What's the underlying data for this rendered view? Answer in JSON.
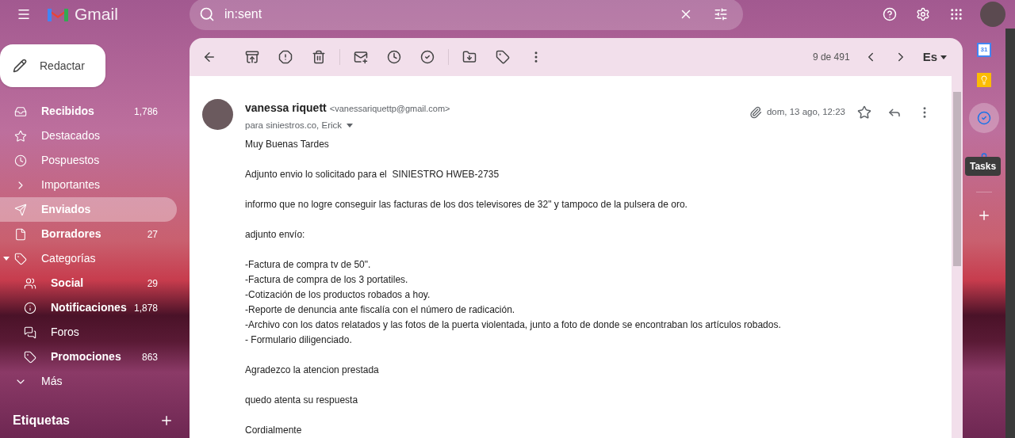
{
  "header": {
    "app_name": "Gmail",
    "search": {
      "value": "in:sent"
    }
  },
  "compose": {
    "label": "Redactar"
  },
  "sidebar": {
    "items": [
      {
        "kind": "folder",
        "label": "Recibidos",
        "count": "1,786",
        "bold": true,
        "selected": false
      },
      {
        "kind": "folder",
        "label": "Destacados",
        "bold": false,
        "selected": false
      },
      {
        "kind": "folder",
        "label": "Pospuestos",
        "bold": false,
        "selected": false
      },
      {
        "kind": "folder",
        "label": "Importantes",
        "bold": false,
        "selected": false
      },
      {
        "kind": "folder",
        "label": "Enviados",
        "bold": true,
        "selected": true
      },
      {
        "kind": "folder",
        "label": "Borradores",
        "count": "27",
        "bold": true,
        "selected": false
      },
      {
        "kind": "group",
        "label": "Categorías",
        "bold": false,
        "selected": false,
        "expanded": true
      },
      {
        "kind": "category",
        "label": "Social",
        "count": "29",
        "bold": true,
        "selected": false
      },
      {
        "kind": "category",
        "label": "Notificaciones",
        "count": "1,878",
        "bold": true,
        "selected": false
      },
      {
        "kind": "category",
        "label": "Foros",
        "bold": false,
        "selected": false
      },
      {
        "kind": "category",
        "label": "Promociones",
        "count": "863",
        "bold": true,
        "selected": false
      },
      {
        "kind": "more",
        "label": "Más",
        "bold": false,
        "selected": false
      }
    ],
    "labels_heading": "Etiquetas"
  },
  "toolbar": {
    "position": "9 de 491",
    "input_tool": "Es"
  },
  "message": {
    "sender_name": "vanessa riquett",
    "sender_email": "<vanessariquettp@gmail.com>",
    "recipients": "para siniestros.co, Erick",
    "date": "dom, 13 ago, 12:23",
    "body": [
      [
        "Muy Buenas Tardes"
      ],
      [
        "Adjunto envio lo solicitado para el  SINIESTRO HWEB-2735"
      ],
      [
        "informo que no logre conseguir las facturas de los dos televisores de 32\" y tampoco de la pulsera de oro."
      ],
      [
        "adjunto envío:"
      ],
      [
        "-Factura de compra tv de 50\".",
        "-Factura de compra de los 3 portatiles.",
        "-Cotización de los productos robados a hoy.",
        "-Reporte de denuncia ante fiscalía con el número de radicación.",
        "-Archivo con los datos relatados y las fotos de la puerta violentada, junto a foto de donde se encontraban los artículos robados.",
        "- Formulario diligenciado."
      ],
      [
        "Agradezco la atencion prestada"
      ],
      [
        "quedo atenta su respuesta"
      ],
      [
        "Cordialmente"
      ]
    ]
  },
  "side_panel": {
    "calendar_day": "31",
    "tooltip": "Tasks"
  }
}
